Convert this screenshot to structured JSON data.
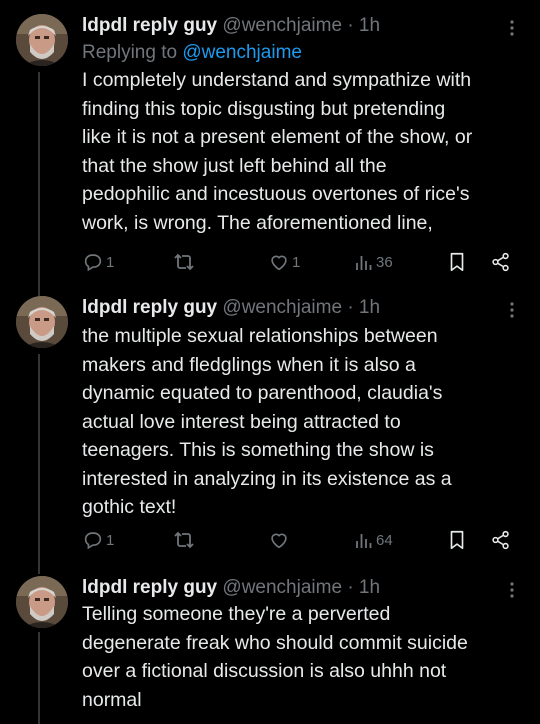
{
  "tweets": [
    {
      "display_name": "ldpdl reply guy",
      "handle": "@wenchjaime",
      "separator": "·",
      "time": "1h",
      "replying_prefix": "Replying to",
      "replying_to": "@wenchjaime",
      "text_lines": [
        "I completely understand and sympathize with",
        "finding this topic disgusting but pretending",
        "like it is not a present element of the show, or",
        "that the show just left behind all the",
        "pedophilic and incestuous overtones of rice's",
        "work, is wrong. The aforementioned line,"
      ],
      "replies": "1",
      "reposts": "",
      "likes": "1",
      "views": "36"
    },
    {
      "display_name": "ldpdl reply guy",
      "handle": "@wenchjaime",
      "separator": "·",
      "time": "1h",
      "text_lines": [
        "the multiple sexual relationships between",
        "makers and fledglings when it is also a",
        "dynamic equated to parenthood, claudia's",
        "actual love interest being attracted to",
        "teenagers. This is something the show is",
        "interested in analyzing in its existence as a",
        "gothic text!"
      ],
      "replies": "1",
      "reposts": "",
      "likes": "",
      "views": "64"
    },
    {
      "display_name": "ldpdl reply guy",
      "handle": "@wenchjaime",
      "separator": "·",
      "time": "1h",
      "text_lines": [
        "Telling someone they're a perverted",
        "degenerate freak who should commit suicide",
        "over a fictional discussion is also uhhh not",
        "normal"
      ]
    }
  ],
  "icons": {
    "reply": "reply-icon",
    "repost": "repost-icon",
    "like": "heart-icon",
    "views": "views-icon",
    "bookmark": "bookmark-icon",
    "share": "share-icon",
    "more": "more-icon"
  },
  "colors": {
    "background": "#000000",
    "text": "#e7e9ea",
    "secondary": "#71767b",
    "link": "#1d9bf0",
    "thread_line": "#333639"
  }
}
